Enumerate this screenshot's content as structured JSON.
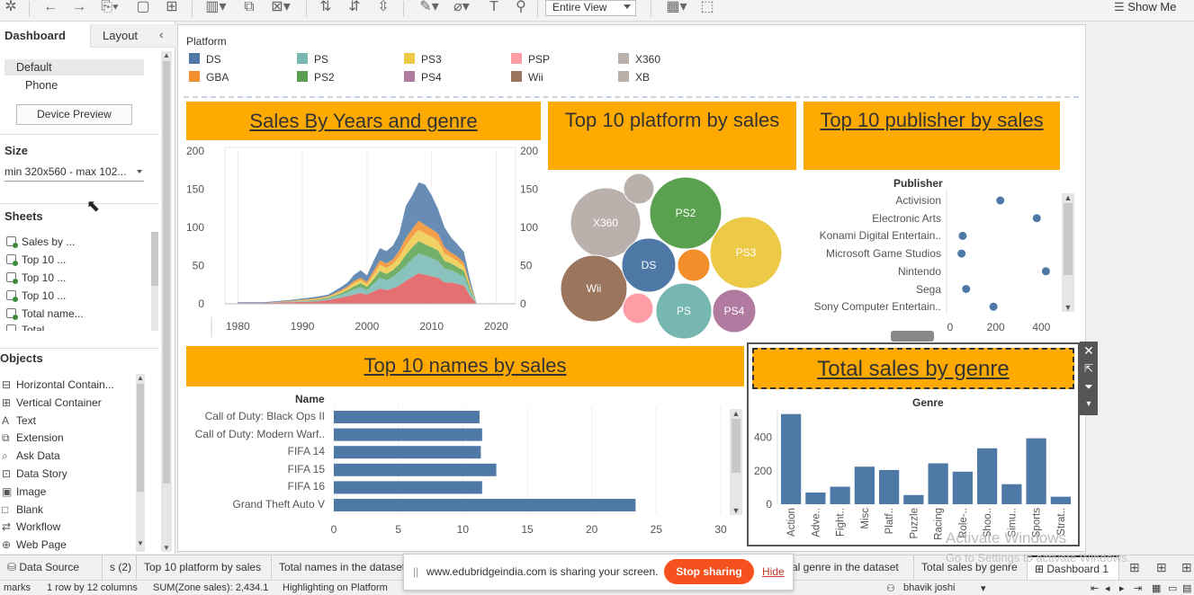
{
  "toolbar": {
    "view_select": "Entire View",
    "show_me": "Show Me"
  },
  "left_panel": {
    "tabs": [
      "Dashboard",
      "Layout"
    ],
    "devices": [
      "Default",
      "Phone"
    ],
    "device_preview": "Device Preview",
    "size_heading": "Size",
    "size_value": "min 320x560 - max 102...",
    "sheets_heading": "Sheets",
    "sheets": [
      "Sales by ...",
      "Top 10 ...",
      "Top 10 ...",
      "Top 10 ...",
      "Total name...",
      "Total ..."
    ],
    "objects_heading": "Objects",
    "objects": [
      {
        "label": "Horizontal Contain...",
        "icon": "hbox"
      },
      {
        "label": "Vertical Container",
        "icon": "vbox"
      },
      {
        "label": "Text",
        "icon": "A"
      },
      {
        "label": "Extension",
        "icon": "ext"
      },
      {
        "label": "Ask Data",
        "icon": "ask"
      },
      {
        "label": "Data Story",
        "icon": "story"
      },
      {
        "label": "Image",
        "icon": "img"
      },
      {
        "label": "Blank",
        "icon": "blank"
      },
      {
        "label": "Workflow",
        "icon": "flow"
      },
      {
        "label": "Web Page",
        "icon": "web"
      }
    ]
  },
  "legend": {
    "title": "Platform",
    "items": [
      {
        "name": "DS",
        "color": "#4e79a7"
      },
      {
        "name": "PS",
        "color": "#76b7b2"
      },
      {
        "name": "PS3",
        "color": "#edc948"
      },
      {
        "name": "PSP",
        "color": "#ff9da7"
      },
      {
        "name": "X360",
        "color": "#bab0ac"
      },
      {
        "name": "GBA",
        "color": "#f28e2b"
      },
      {
        "name": "PS2",
        "color": "#59a14f"
      },
      {
        "name": "PS4",
        "color": "#b07aa1"
      },
      {
        "name": "Wii",
        "color": "#9c755f"
      },
      {
        "name": "XB",
        "color": "#bab0ac"
      }
    ]
  },
  "titles": {
    "sales_years": "Sales By Years and genre",
    "top_platform": "Top 10 platform by sales",
    "top_publisher": "Top 10 publisher by sales",
    "top_names": "Top 10 names by sales",
    "total_genre": "Total sales by genre"
  },
  "chart_data": [
    {
      "type": "area",
      "title": "Sales By Years and genre",
      "x_ticks": [
        "1980",
        "1990",
        "2000",
        "2010",
        "2020"
      ],
      "y_ticks": [
        "0",
        "50",
        "100",
        "150",
        "200"
      ],
      "xlim": [
        1978,
        2023
      ],
      "ylim": [
        0,
        200
      ],
      "x": [
        1980,
        1984,
        1988,
        1992,
        1994,
        1996,
        1997,
        1998,
        1999,
        2000,
        2001,
        2002,
        2003,
        2004,
        2005,
        2006,
        2007,
        2008,
        2009,
        2010,
        2011,
        2012,
        2013,
        2014,
        2015,
        2016,
        2017
      ],
      "series": [
        {
          "name": "Red",
          "color": "#e15759",
          "values": [
            1,
            1,
            2,
            3,
            5,
            8,
            10,
            12,
            14,
            12,
            16,
            20,
            18,
            20,
            24,
            30,
            35,
            40,
            38,
            36,
            34,
            28,
            28,
            26,
            24,
            10,
            0
          ]
        },
        {
          "name": "Teal",
          "color": "#76b7b2",
          "values": [
            0,
            0,
            1,
            1,
            2,
            4,
            5,
            7,
            8,
            6,
            10,
            14,
            13,
            15,
            18,
            20,
            24,
            26,
            25,
            24,
            22,
            18,
            16,
            14,
            12,
            6,
            0
          ]
        },
        {
          "name": "Green",
          "color": "#59a14f",
          "values": [
            0,
            0,
            0,
            1,
            1,
            2,
            3,
            4,
            5,
            4,
            6,
            9,
            8,
            9,
            10,
            14,
            15,
            16,
            15,
            14,
            14,
            10,
            9,
            8,
            7,
            3,
            0
          ]
        },
        {
          "name": "Yellow",
          "color": "#edc948",
          "values": [
            0,
            0,
            0,
            1,
            1,
            2,
            3,
            4,
            4,
            4,
            6,
            8,
            8,
            8,
            10,
            12,
            14,
            15,
            14,
            14,
            12,
            10,
            8,
            8,
            6,
            3,
            0
          ]
        },
        {
          "name": "Orange",
          "color": "#f28e2b",
          "values": [
            0,
            0,
            1,
            1,
            1,
            2,
            2,
            3,
            3,
            3,
            5,
            6,
            6,
            6,
            8,
            10,
            10,
            12,
            11,
            10,
            10,
            8,
            6,
            6,
            5,
            2,
            0
          ]
        },
        {
          "name": "Blue",
          "color": "#4e79a7",
          "values": [
            1,
            1,
            1,
            2,
            2,
            4,
            5,
            8,
            10,
            8,
            13,
            16,
            16,
            18,
            22,
            42,
            44,
            50,
            53,
            44,
            32,
            26,
            20,
            16,
            14,
            6,
            0
          ]
        }
      ]
    },
    {
      "type": "bubble",
      "title": "Top 10 platform by sales",
      "bubbles": [
        {
          "name": "PS2",
          "label": "PS2",
          "color": "#59a14f",
          "r": 40,
          "cx": 762,
          "cy": 237
        },
        {
          "name": "X360",
          "label": "X360",
          "color": "#bab0ac",
          "r": 39,
          "cx": 673,
          "cy": 248
        },
        {
          "name": "PS3",
          "label": "PS3",
          "color": "#edc948",
          "r": 40,
          "cx": 829,
          "cy": 281
        },
        {
          "name": "Wii",
          "label": "Wii",
          "color": "#9c755f",
          "r": 37,
          "cx": 660,
          "cy": 321
        },
        {
          "name": "DS",
          "label": "DS",
          "color": "#4e79a7",
          "r": 30,
          "cx": 721,
          "cy": 295
        },
        {
          "name": "PS",
          "label": "PS",
          "color": "#76b7b2",
          "r": 31,
          "cx": 760,
          "cy": 346
        },
        {
          "name": "GBA",
          "label": "",
          "color": "#f28e2b",
          "r": 18,
          "cx": 771,
          "cy": 295
        },
        {
          "name": "PS4",
          "label": "PS4",
          "color": "#b07aa1",
          "r": 24,
          "cx": 816,
          "cy": 346
        },
        {
          "name": "PSP",
          "label": "",
          "color": "#ff9da7",
          "r": 17,
          "cx": 709,
          "cy": 343
        },
        {
          "name": "XB",
          "label": "",
          "color": "#bab0ac",
          "r": 17,
          "cx": 710,
          "cy": 210
        }
      ]
    },
    {
      "type": "scatter",
      "title": "Top 10 publisher by sales",
      "header": "Publisher",
      "categories": [
        "Activision",
        "Electronic Arts",
        "Konami Digital Entertain..",
        "Microsoft Game Studios",
        "Nintendo",
        "Sega",
        "Sony Computer Entertain.."
      ],
      "values": [
        220,
        380,
        55,
        50,
        420,
        70,
        190
      ],
      "x_ticks": [
        "0",
        "200",
        "400"
      ],
      "xlim": [
        0,
        450
      ]
    },
    {
      "type": "bar",
      "title": "Top 10 names by sales",
      "header": "Name",
      "categories": [
        "Call of Duty: Black Ops II",
        "Call of Duty: Modern Warf..",
        "FIFA 14",
        "FIFA 15",
        "FIFA 16",
        "Grand Theft Auto V"
      ],
      "values": [
        11.3,
        11.5,
        11.4,
        12.6,
        11.5,
        23.4
      ],
      "x_ticks": [
        "0",
        "5",
        "10",
        "15",
        "20",
        "25",
        "30"
      ],
      "xlim": [
        0,
        30
      ]
    },
    {
      "type": "bar",
      "title": "Total sales by genre",
      "header": "Genre",
      "categories": [
        "Action",
        "Adve..",
        "Fight..",
        "Misc",
        "Platf..",
        "Puzzle",
        "Racing",
        "Role-..",
        "Shoo..",
        "Simu..",
        "Sports",
        "Strat.."
      ],
      "values": [
        540,
        70,
        105,
        225,
        205,
        55,
        245,
        195,
        335,
        120,
        395,
        45
      ],
      "y_ticks": [
        "0",
        "200",
        "400"
      ],
      "ylim": [
        0,
        560
      ]
    }
  ],
  "tabs_bar": [
    "Data Source",
    "s (2)",
    "Top 10 platform by sales",
    "Total names in the dataset",
    "al genre in the dataset",
    "Total sales by genre",
    "Dashboard 1"
  ],
  "status": {
    "marks": "marks",
    "rows": "1 row by 12 columns",
    "sum": "SUM(Zone sales): 2,434.1",
    "highlight": "Highlighting on Platform",
    "user": "bhavik joshi"
  },
  "share_bar": {
    "message": "www.edubridgeindia.com is sharing your screen.",
    "stop": "Stop sharing",
    "hide": "Hide"
  },
  "watermark": {
    "line1": "Activate Windows",
    "line2": "Go to Settings to activate Windows."
  },
  "colors": {
    "title_bg": "#ffaa00",
    "bar": "#4e79a7",
    "stop_btn": "#f4511e"
  }
}
